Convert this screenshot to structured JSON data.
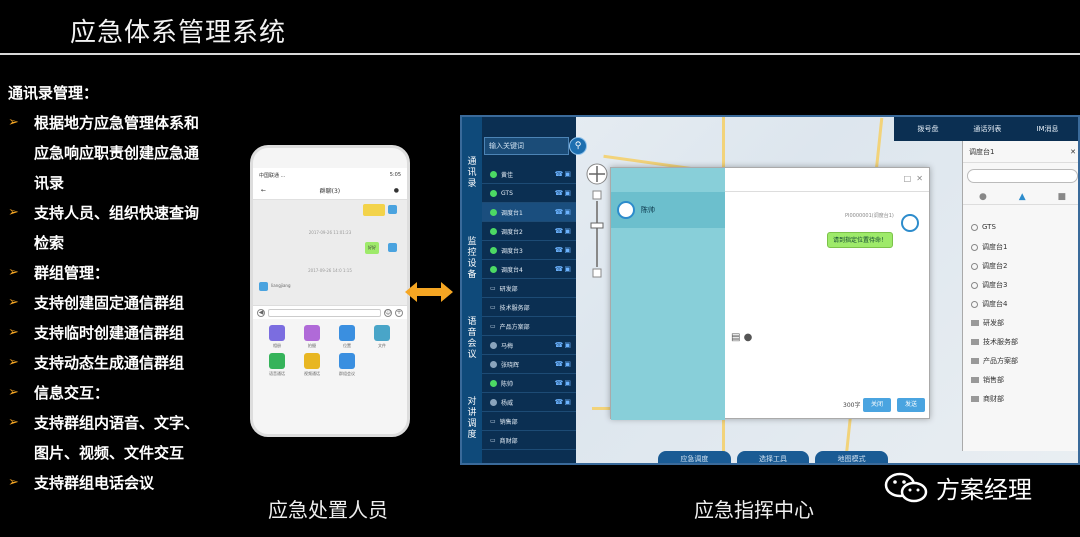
{
  "slide": {
    "title": "应急体系管理系统"
  },
  "bullets": [
    {
      "arrow": false,
      "text": "通讯录管理："
    },
    {
      "arrow": true,
      "text": " 根据地方应急管理体系和"
    },
    {
      "arrow": false,
      "text": "应急响应职责创建应急通",
      "indent": true
    },
    {
      "arrow": false,
      "text": "讯录",
      "indent": true
    },
    {
      "arrow": true,
      "text": " 支持人员、组织快速查询"
    },
    {
      "arrow": false,
      "text": "检索",
      "indent": true
    },
    {
      "arrow": true,
      "text": "群组管理："
    },
    {
      "arrow": true,
      "text": " 支持创建固定通信群组"
    },
    {
      "arrow": true,
      "text": " 支持临时创建通信群组"
    },
    {
      "arrow": true,
      "text": " 支持动态生成通信群组"
    },
    {
      "arrow": true,
      "text": "信息交互："
    },
    {
      "arrow": true,
      "text": " 支持群组内语音、文字、"
    },
    {
      "arrow": false,
      "text": "图片、视频、文件交互",
      "indent": true
    },
    {
      "arrow": true,
      "text": " 支持群组电话会议"
    }
  ],
  "captions": {
    "left": "应急处置人员",
    "right": "应急指挥中心"
  },
  "watermark": {
    "text": "方案经理",
    "icon": "wechat-icon"
  },
  "phone": {
    "status_left": "中国联通 ...",
    "status_right": "5:05",
    "chat_title": "群聊(3)",
    "time1": "2017-09-26 11:01:23",
    "time2": "2017-09-26 14:0 1:15",
    "bubble1": "好好",
    "sender": "liangjiang",
    "apps": [
      {
        "label": "相册",
        "color": "#7b6de0"
      },
      {
        "label": "拍摄",
        "color": "#b06ad8"
      },
      {
        "label": "位置",
        "color": "#3a8fe0"
      },
      {
        "label": "文件",
        "color": "#49a5c8"
      },
      {
        "label": "语音通话",
        "color": "#35b35a"
      },
      {
        "label": "视频通话",
        "color": "#e8b622"
      },
      {
        "label": "群组会议",
        "color": "#3a8fe0"
      }
    ]
  },
  "desktop": {
    "search_placeholder": "输入关键词",
    "sidebar_tabs": [
      "通讯录",
      "监控设备",
      "语音会议",
      "对讲调度"
    ],
    "contacts": [
      {
        "name": "黄佳",
        "type": "person",
        "online": true
      },
      {
        "name": "GTS",
        "type": "person",
        "online": true
      },
      {
        "name": "调度台1",
        "type": "person",
        "online": true
      },
      {
        "name": "调度台2",
        "type": "person",
        "online": true
      },
      {
        "name": "调度台3",
        "type": "person",
        "online": true
      },
      {
        "name": "调度台4",
        "type": "person",
        "online": true
      },
      {
        "name": "研发部",
        "type": "folder"
      },
      {
        "name": "技术服务部",
        "type": "folder"
      },
      {
        "name": "产品方案部",
        "type": "folder"
      },
      {
        "name": "马梅",
        "type": "person",
        "online": false
      },
      {
        "name": "张晓辉",
        "type": "person",
        "online": false
      },
      {
        "name": "陈帅",
        "type": "person",
        "online": true
      },
      {
        "name": "杨威",
        "type": "person",
        "online": false
      },
      {
        "name": "销售部",
        "type": "folder"
      },
      {
        "name": "商财部",
        "type": "folder"
      }
    ],
    "top_actions": [
      "拨号盘",
      "通话列表",
      "IM消息"
    ],
    "dialog": {
      "contact": "陈帅",
      "meta": "PI0000001(调度台1)",
      "message": "请到指定位置待命！",
      "count": "300字",
      "close_btn": "关闭",
      "send_btn": "发送"
    },
    "right_panel": {
      "title": "调度台1",
      "items": [
        {
          "name": "GTS",
          "type": "person"
        },
        {
          "name": "调度台1",
          "type": "person"
        },
        {
          "name": "调度台2",
          "type": "person"
        },
        {
          "name": "调度台3",
          "type": "person"
        },
        {
          "name": "调度台4",
          "type": "person"
        },
        {
          "name": "研发部",
          "type": "folder"
        },
        {
          "name": "技术服务部",
          "type": "folder"
        },
        {
          "name": "产品方案部",
          "type": "folder"
        },
        {
          "name": "销售部",
          "type": "folder"
        },
        {
          "name": "商财部",
          "type": "folder"
        }
      ]
    },
    "bottom_tabs": [
      "应急调度",
      "选择工具",
      "地图模式"
    ]
  },
  "colors": {
    "accent": "#f5a623",
    "app_dark": "#0b2f52",
    "dialog_left": "#88cfd9",
    "bubble": "#9eea6a"
  }
}
